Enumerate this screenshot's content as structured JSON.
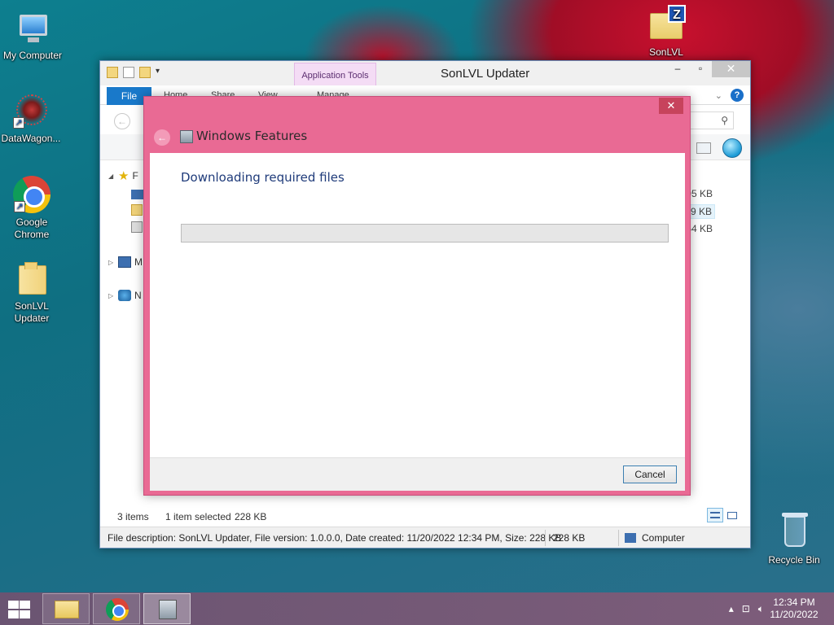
{
  "desktop": {
    "icons": [
      {
        "label": "My Computer",
        "icon": "computer-icon"
      },
      {
        "label": "DataWagon...",
        "icon": "datawagon-icon"
      },
      {
        "label": "Google Chrome",
        "icon": "chrome-icon"
      },
      {
        "label": "SonLVL Updater",
        "icon": "folder-icon"
      },
      {
        "label": "SonLVL",
        "icon": "zip-folder-icon"
      },
      {
        "label": "Recycle Bin",
        "icon": "recycle-bin-icon"
      }
    ]
  },
  "explorer": {
    "title": "SonLVL Updater",
    "contextual_tab_group": "Application Tools",
    "tabs": {
      "file": "File",
      "home": "Home",
      "share": "Share",
      "view": "View",
      "manage": "Manage"
    },
    "navpane": {
      "favorites_letter": "F",
      "computer_letter": "M",
      "network_letter": "N"
    },
    "file_sizes": [
      "95 KB",
      "29 KB",
      "54 KB"
    ],
    "status": {
      "item_count": "3 items",
      "selection": "1 item selected",
      "selection_size": "228 KB",
      "details": "File description: SonLVL Updater, File version: 1.0.0.0, Date created: 11/20/2022 12:34 PM, Size: 228 KB",
      "size": "228 KB",
      "location": "Computer"
    }
  },
  "dialog": {
    "title": "Windows Features",
    "heading": "Downloading required files",
    "progress": 0,
    "cancel_label": "Cancel",
    "close_glyph": "✕"
  },
  "taskbar": {
    "apps": [
      "file-explorer",
      "google-chrome",
      "windows-features"
    ],
    "time": "12:34 PM",
    "date": "11/20/2022"
  },
  "colors": {
    "dialog_frame": "#e96a94",
    "accent_blue": "#1979ca",
    "heading_blue": "#1f3b7a"
  }
}
